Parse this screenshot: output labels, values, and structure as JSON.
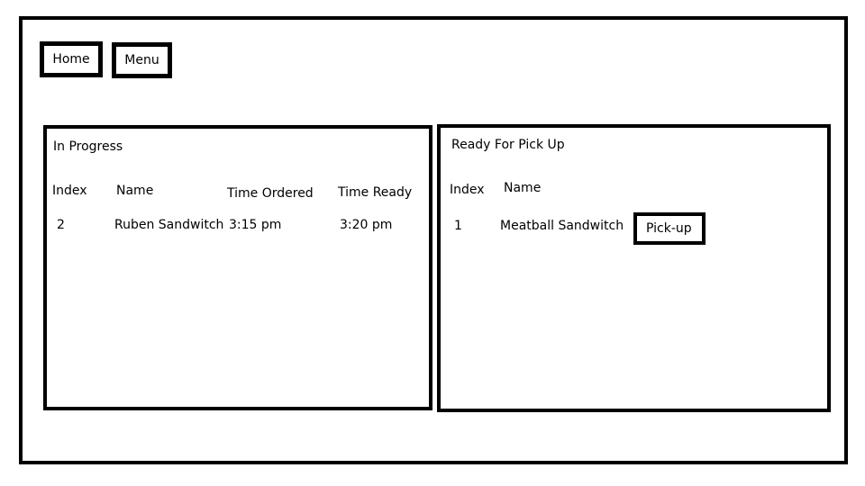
{
  "nav": {
    "home_label": "Home",
    "menu_label": "Menu"
  },
  "in_progress": {
    "title": "In Progress",
    "columns": [
      "Index",
      "Name",
      "Time Ordered",
      "Time Ready"
    ],
    "rows": [
      {
        "index": "2",
        "name": "Ruben Sandwitch",
        "time_ordered": "3:15 pm",
        "time_ready": "3:20 pm"
      }
    ]
  },
  "ready": {
    "title": "Ready For Pick Up",
    "columns": [
      "Index",
      "Name"
    ],
    "rows": [
      {
        "index": "1",
        "name": "Meatball Sandwitch",
        "action": "Pick-up"
      }
    ]
  }
}
